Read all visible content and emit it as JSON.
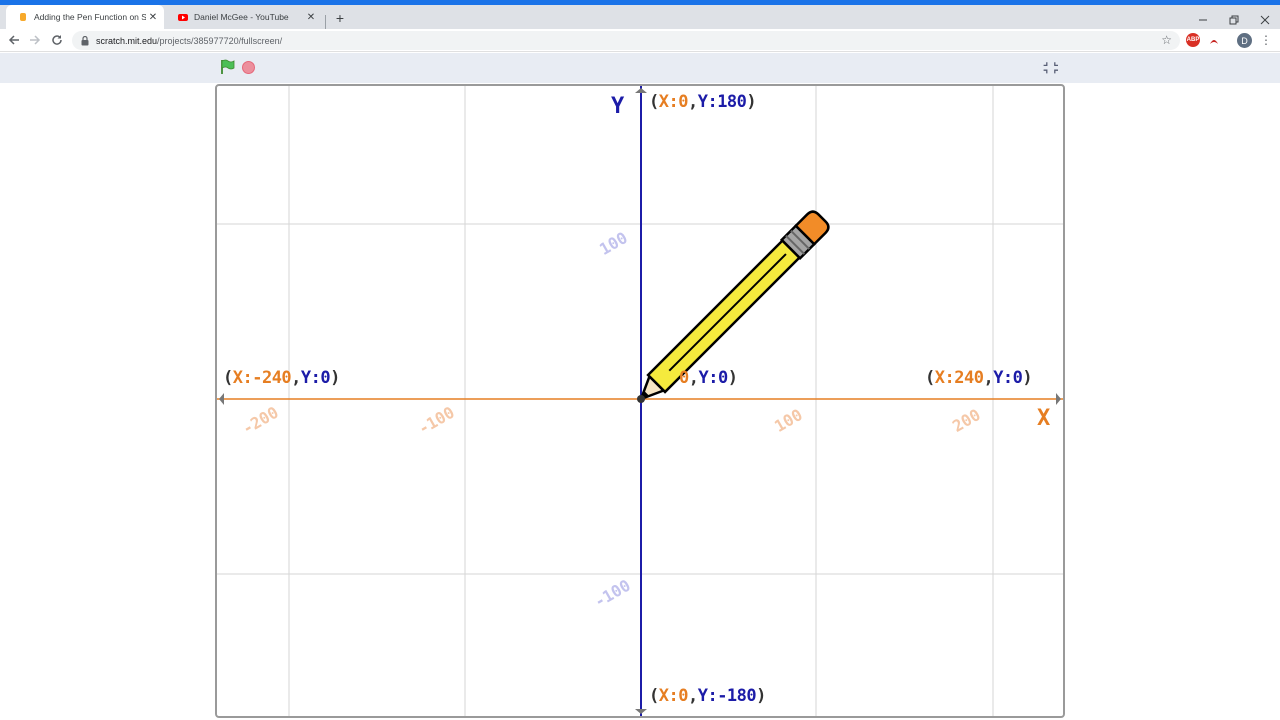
{
  "browser": {
    "tabs": [
      {
        "title": "Adding the Pen Function on Scra",
        "favicon": "scratch-icon",
        "active": true
      },
      {
        "title": "Daniel McGee - YouTube",
        "favicon": "youtube-icon",
        "active": false
      }
    ],
    "url_host": "scratch.mit.edu",
    "url_path": "/projects/385977720/fullscreen/",
    "profile_initial": "D",
    "extension_abp": "ABP",
    "colors": {
      "accent": "#1a73e8",
      "tabstrip": "#dee1e6"
    }
  },
  "player": {
    "flag_icon": "green-flag-icon",
    "stop_icon": "stop-icon",
    "unfullscreen_icon": "unfullscreen-icon"
  },
  "stage": {
    "axis_y_letter": "Y",
    "axis_x_letter": "X",
    "labels": {
      "top": {
        "open": "(",
        "x": "X:0",
        "sep": ",",
        "y": "Y:180",
        "close": ")"
      },
      "bottom": {
        "open": "(",
        "x": "X:0",
        "sep": ",",
        "y": "Y:-180",
        "close": ")"
      },
      "left": {
        "open": "(",
        "x": "X:-240",
        "sep": ",",
        "y": "Y:0",
        "close": ")"
      },
      "right": {
        "open": "(",
        "x": "X:240",
        "sep": ",",
        "y": "Y:0",
        "close": ")"
      },
      "center_partial": {
        "x": "0",
        "sep": ",",
        "y": "Y:0",
        "close": ")"
      }
    },
    "x_ticks": [
      "-200",
      "-100",
      "100",
      "200"
    ],
    "y_ticks": [
      "100",
      "-100"
    ],
    "sprite": "pencil-sprite",
    "colors": {
      "x_axis": "#e67e22",
      "y_axis": "#1c1ca8",
      "grid": "#d6d6d6"
    }
  }
}
